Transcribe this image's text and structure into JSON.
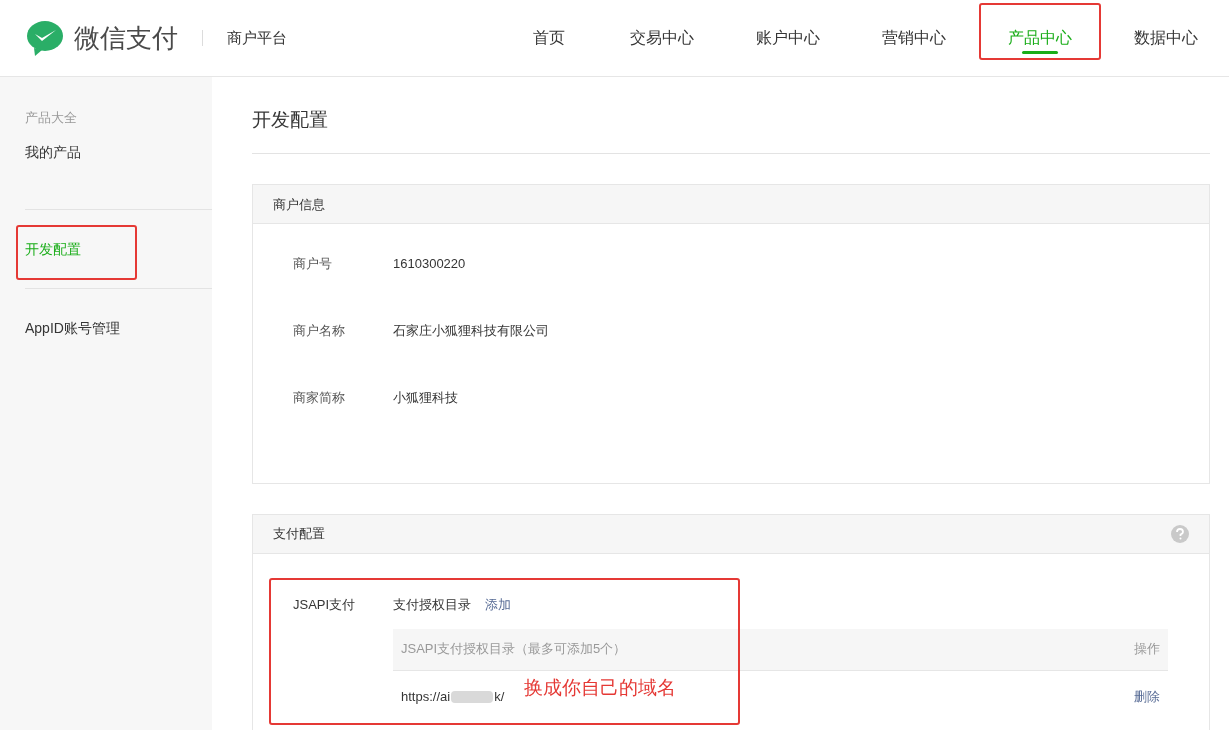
{
  "header": {
    "brand": "微信支付",
    "platform": "商户平台",
    "nav": [
      {
        "label": "首页",
        "selected": false,
        "highlighted": false
      },
      {
        "label": "交易中心",
        "selected": false,
        "highlighted": false
      },
      {
        "label": "账户中心",
        "selected": false,
        "highlighted": false
      },
      {
        "label": "营销中心",
        "selected": false,
        "highlighted": false
      },
      {
        "label": "产品中心",
        "selected": true,
        "highlighted": true
      },
      {
        "label": "数据中心",
        "selected": false,
        "highlighted": false
      }
    ]
  },
  "sidebar": {
    "items": [
      {
        "label": "产品大全",
        "kind": "heading"
      },
      {
        "label": "我的产品",
        "kind": "link",
        "selected": false,
        "highlighted": false
      },
      {
        "label": "开发配置",
        "kind": "link",
        "selected": true,
        "highlighted": true
      },
      {
        "label": "AppID账号管理",
        "kind": "link",
        "selected": false,
        "highlighted": false
      }
    ]
  },
  "page_title": "开发配置",
  "merchant_info": {
    "title": "商户信息",
    "fields": [
      {
        "label": "商户号",
        "value": "1610300220"
      },
      {
        "label": "商户名称",
        "value": "石家庄小狐狸科技有限公司"
      },
      {
        "label": "商家简称",
        "value": "小狐狸科技"
      }
    ]
  },
  "payment_config": {
    "title": "支付配置",
    "jsapi": {
      "label": "JSAPI支付",
      "directory_label": "支付授权目录",
      "add_link": "添加",
      "table": {
        "columns": [
          "JSAPI支付授权目录（最多可添加5个）",
          "操作"
        ],
        "rows": [
          {
            "url_start": "https://ai",
            "url_end": "k/",
            "action": "删除"
          }
        ]
      },
      "annotation": "换成你自己的域名"
    }
  }
}
